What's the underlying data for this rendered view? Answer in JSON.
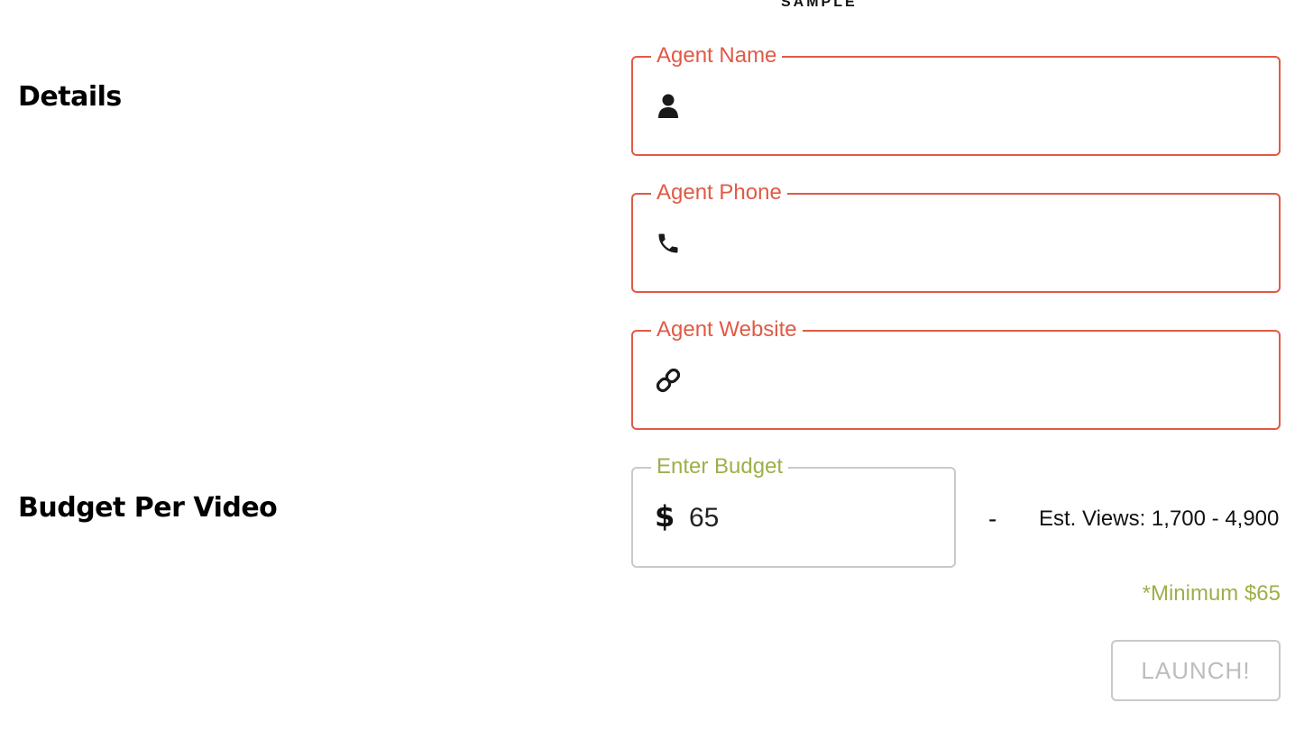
{
  "header": {
    "sample_label": "SAMPLE"
  },
  "sections": {
    "details_title": "Details",
    "budget_title": "Budget Per Video"
  },
  "fields": {
    "agent_name": {
      "label": "Agent Name",
      "value": "",
      "icon": "user-icon"
    },
    "agent_phone": {
      "label": "Agent Phone",
      "value": "",
      "icon": "phone-icon"
    },
    "agent_website": {
      "label": "Agent Website",
      "value": "",
      "icon": "link-icon"
    }
  },
  "budget": {
    "label": "Enter Budget",
    "currency_symbol": "$",
    "value": "65",
    "dash": "-",
    "est_views": "Est. Views: 1,700 - 4,900",
    "minimum_note": "*Minimum $65"
  },
  "actions": {
    "launch_label": "LAUNCH!"
  },
  "colors": {
    "error_red": "#e05a45",
    "accent_green": "#9cb04a",
    "disabled_gray": "#c9c9c9"
  }
}
